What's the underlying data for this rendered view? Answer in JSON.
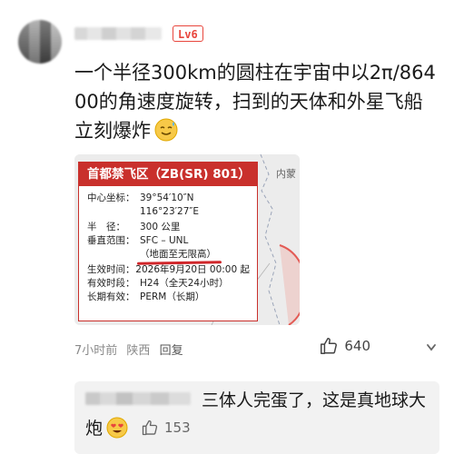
{
  "comment": {
    "level_badge": "Lv6",
    "text": "一个半径300km的圆柱在宇宙中以2π/86400的角速度旋转，扫到的天体和外星飞船立刻爆炸",
    "emoji_icon": "sweat-smile-emoji-icon"
  },
  "map_card": {
    "region_label": "内蒙",
    "title": "首都禁飞区（ZB(SR) 801）",
    "rows": {
      "center_label": "中心坐标：",
      "center_lat": "39°54′10″N",
      "center_lon": "116°23′27″E",
      "radius_label": "半　径：",
      "radius_value": "300 公里",
      "vertical_label": "垂直范围：",
      "vertical_value": "SFC – UNL",
      "vertical_note": "（地面至无限高）",
      "effective_time_label": "生效时间：",
      "effective_time_value": "2026年9月20日 00:00 起",
      "effective_period_label": "有效时段：",
      "effective_period_value": "H24（全天24小时）",
      "validity_label": "长期有效：",
      "validity_value": "PERM（长期）"
    },
    "colors": {
      "accent": "#c9302c",
      "underline": "#d0262a"
    }
  },
  "meta": {
    "time": "7小时前",
    "location": "陕西",
    "reply": "回复",
    "likes": "640"
  },
  "reply": {
    "text": "三体人完蛋了，这是真地球大炮",
    "emoji_icon": "heart-eyes-emoji-icon",
    "likes": "153"
  }
}
